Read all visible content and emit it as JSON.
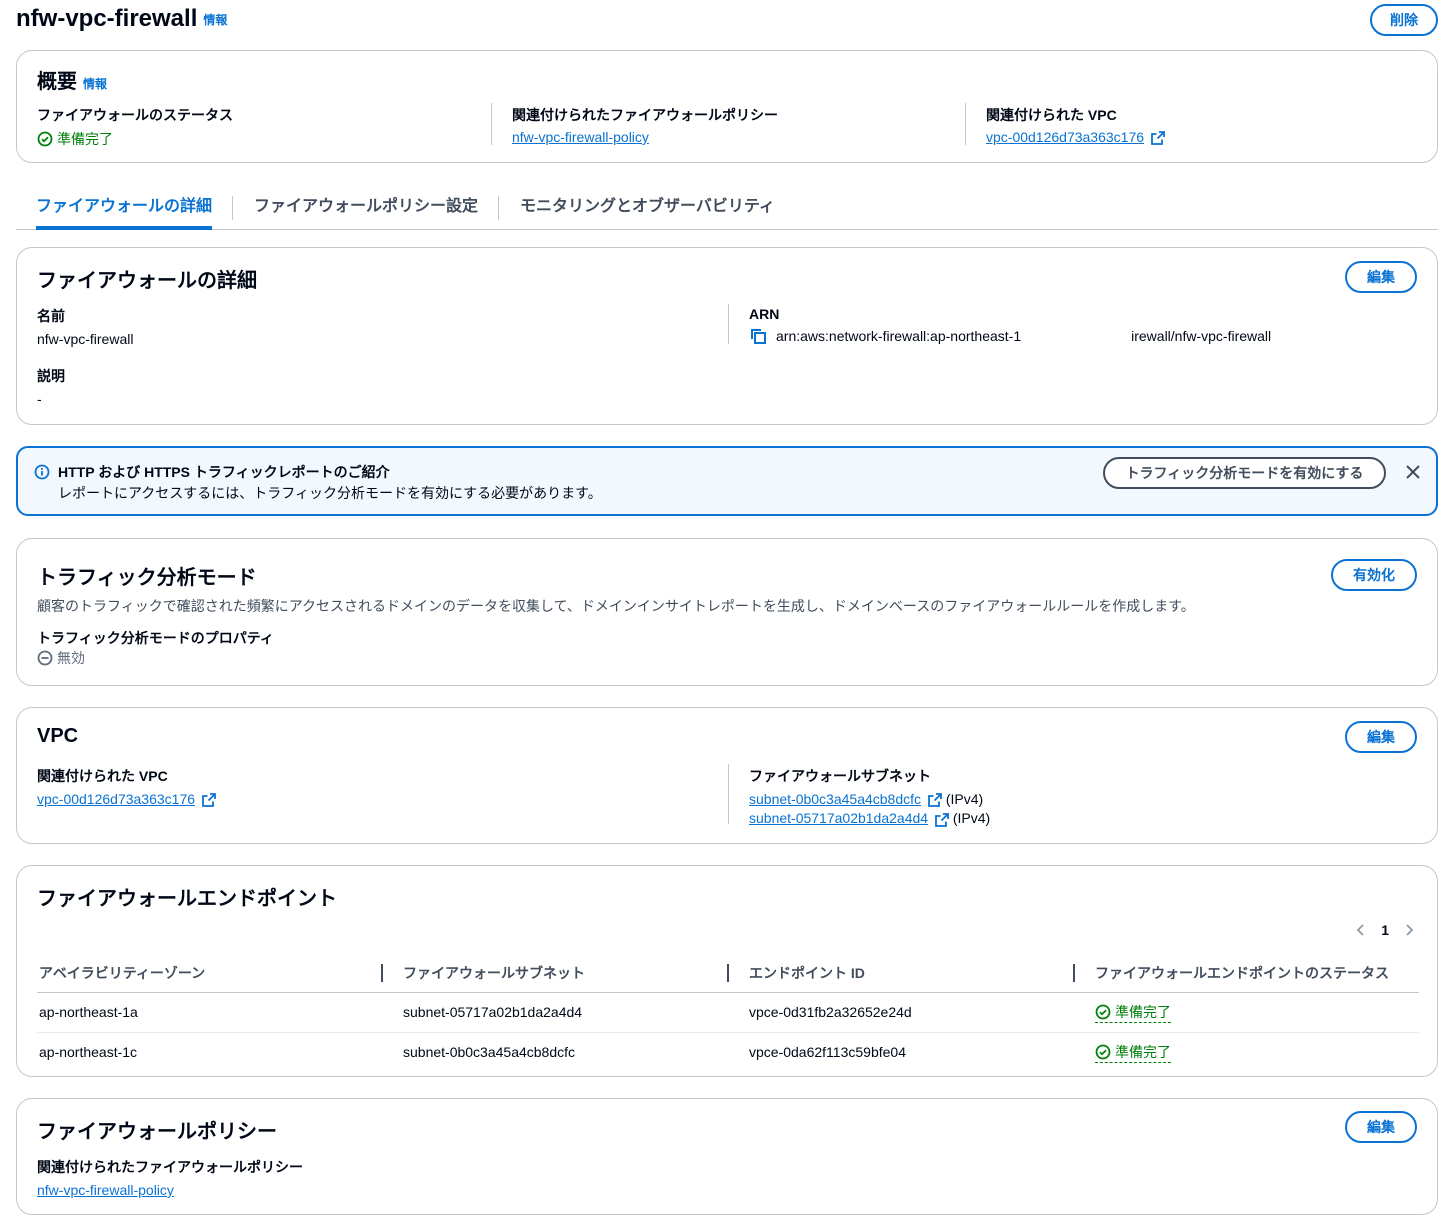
{
  "header": {
    "title": "nfw-vpc-firewall",
    "info": "情報",
    "delete": "削除"
  },
  "overview": {
    "title": "概要",
    "info": "情報",
    "status_label": "ファイアウォールのステータス",
    "status_value": "準備完了",
    "policy_label": "関連付けられたファイアウォールポリシー",
    "policy_value": "nfw-vpc-firewall-policy",
    "vpc_label": "関連付けられた VPC",
    "vpc_value": "vpc-00d126d73a363c176"
  },
  "tabs": [
    {
      "label": "ファイアウォールの詳細",
      "active": true
    },
    {
      "label": "ファイアウォールポリシー設定",
      "active": false
    },
    {
      "label": "モニタリングとオブザーバビリティ",
      "active": false
    }
  ],
  "details": {
    "title": "ファイアウォールの詳細",
    "edit": "編集",
    "name_label": "名前",
    "name_value": "nfw-vpc-firewall",
    "arn_label": "ARN",
    "arn_value_left": "arn:aws:network-firewall:ap-northeast-1",
    "arn_value_right": "irewall/nfw-vpc-firewall",
    "desc_label": "説明",
    "desc_value": "-"
  },
  "alert": {
    "title": "HTTP および HTTPS トラフィックレポートのご紹介",
    "body": "レポートにアクセスするには、トラフィック分析モードを有効にする必要があります。",
    "action": "トラフィック分析モードを有効にする"
  },
  "traffic": {
    "title": "トラフィック分析モード",
    "enable": "有効化",
    "description": "顧客のトラフィックで確認された頻繁にアクセスされるドメインのデータを収集して、ドメインインサイトレポートを生成し、ドメインベースのファイアウォールルールを作成します。",
    "prop_label": "トラフィック分析モードのプロパティ",
    "prop_value": "無効"
  },
  "vpc": {
    "title": "VPC",
    "edit": "編集",
    "vpc_label": "関連付けられた VPC",
    "vpc_value": "vpc-00d126d73a363c176",
    "subnet_label": "ファイアウォールサブネット",
    "subnets": [
      {
        "id": "subnet-0b0c3a45a4cb8dcfc",
        "type": "(IPv4)"
      },
      {
        "id": "subnet-05717a02b1da2a4d4",
        "type": "(IPv4)"
      }
    ]
  },
  "endpoints": {
    "title": "ファイアウォールエンドポイント",
    "page": "1",
    "columns": [
      "アベイラビリティーゾーン",
      "ファイアウォールサブネット",
      "エンドポイント ID",
      "ファイアウォールエンドポイントのステータス"
    ],
    "rows": [
      {
        "az": "ap-northeast-1a",
        "subnet": "subnet-05717a02b1da2a4d4",
        "endpoint": "vpce-0d31fb2a32652e24d",
        "status": "準備完了"
      },
      {
        "az": "ap-northeast-1c",
        "subnet": "subnet-0b0c3a45a4cb8dcfc",
        "endpoint": "vpce-0da62f113c59bfe04",
        "status": "準備完了"
      }
    ]
  },
  "policy": {
    "title": "ファイアウォールポリシー",
    "edit": "編集",
    "label": "関連付けられたファイアウォールポリシー",
    "value": "nfw-vpc-firewall-policy"
  },
  "colors": {
    "accent": "#0972d3",
    "success": "#037f0c",
    "border": "#c6c6cd",
    "info_bg": "#f2f8fd"
  },
  "icons": [
    "check-circle-icon",
    "external-link-icon",
    "copy-icon",
    "info-icon",
    "close-icon",
    "minus-circle-icon",
    "chevron-left-icon",
    "chevron-right-icon"
  ]
}
